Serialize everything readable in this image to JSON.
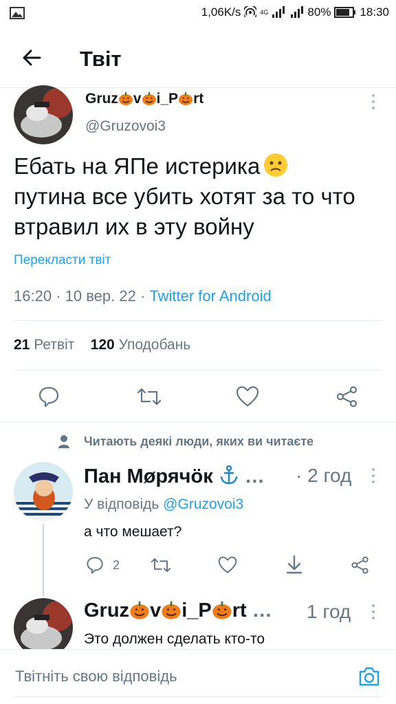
{
  "status_bar": {
    "speed": "1,06K/s",
    "network": "4G",
    "battery": "80%",
    "time": "18:30"
  },
  "header": {
    "title": "Твіт",
    "back_icon": "arrow-left-icon"
  },
  "tweet": {
    "name_part1": "Gruz",
    "name_part2": "v",
    "name_part3": "i_P",
    "name_part4": "rt",
    "handle": "@Gruzovoi3",
    "text": "Ебать на ЯПе истерика",
    "text_line2": "путина все убить хотят за то что втравил их в эту войну",
    "emoji": "slightly-frowning-face",
    "translate": "Перекласти твіт",
    "time": "16:20",
    "date": "10 вер. 22",
    "source": "Twitter for Android",
    "retweets": "21",
    "retweets_label": "Ретвіт",
    "likes": "120",
    "likes_label": "Уподобань"
  },
  "social_context": "Читають деякі люди, яких ви читаєте",
  "replies": [
    {
      "name": "Пан Møрячöк",
      "name_suffix": "…",
      "time": "· 2 год",
      "reply_to_label": "У відповідь",
      "reply_to_handle": "@Gruzovoi3",
      "text": "а что мешает?",
      "reply_count": "2"
    },
    {
      "name_part1": "Gruz",
      "name_part2": "v",
      "name_part3": "i_P",
      "name_part4": "rt",
      "name_suffix": "…",
      "time": "1 год",
      "text": "Это должен сделать кто-то"
    }
  ],
  "compose": {
    "placeholder": "Твітніть свою відповідь"
  },
  "colors": {
    "accent": "#1da1f2",
    "secondary_text": "#657786",
    "divider": "#e6ecf0"
  }
}
